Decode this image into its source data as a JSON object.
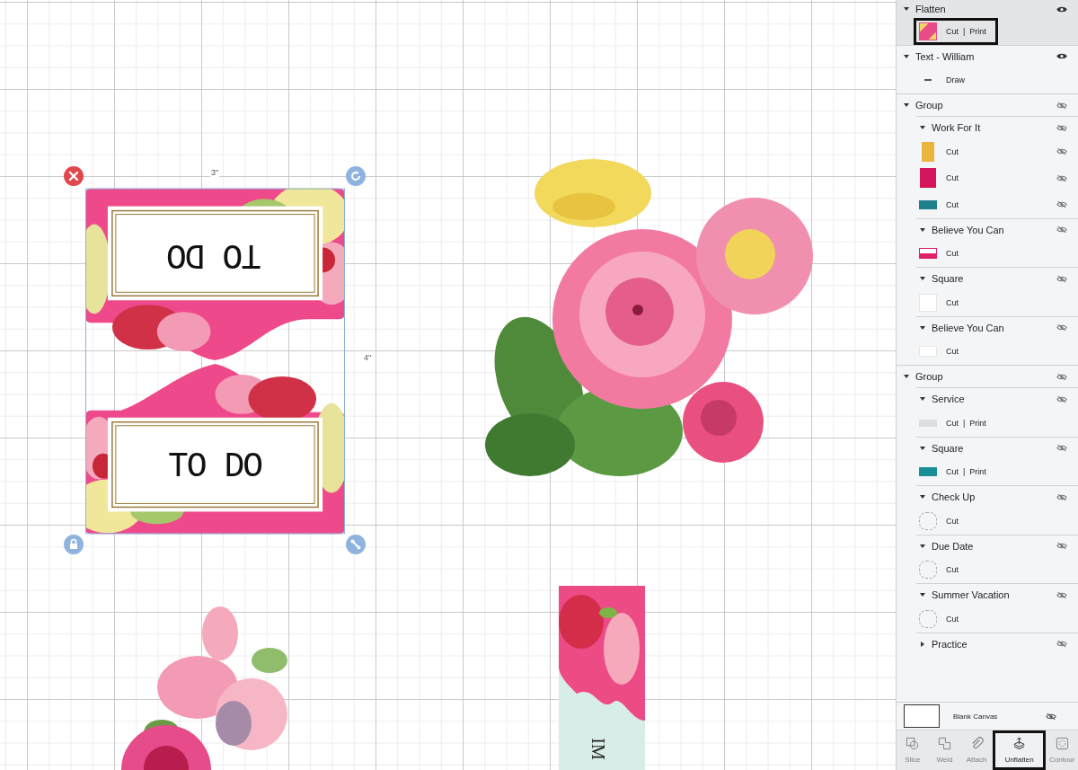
{
  "canvas": {
    "selection": {
      "width_label": "3\"",
      "height_label": "4\""
    },
    "card": {
      "top_text": "TO DO",
      "bottom_text": "TO DO"
    },
    "bookmark": {
      "text": "IM"
    }
  },
  "layers": [
    {
      "name": "Flatten",
      "expanded": true,
      "selected": true,
      "visible": true,
      "children": [
        {
          "kind": "pattern",
          "operation": "Cut  |  Print",
          "annotated": true
        }
      ]
    },
    {
      "name": "Text - William",
      "expanded": true,
      "selected": false,
      "visible": true,
      "children": [
        {
          "kind": "dash",
          "operation": "Draw"
        }
      ]
    },
    {
      "name": "Group",
      "expanded": true,
      "selected": false,
      "visible": false,
      "children": [
        {
          "name": "Work For It",
          "expanded": true,
          "selected": false,
          "visible": false,
          "children": [
            {
              "kind": "yellow-tag",
              "operation": "Cut",
              "visible": false
            },
            {
              "kind": "pink-tag",
              "operation": "Cut",
              "visible": false
            },
            {
              "kind": "teal-tag",
              "operation": "Cut",
              "visible": false
            }
          ]
        },
        {
          "name": "Believe You Can",
          "expanded": true,
          "selected": false,
          "visible": false,
          "children": [
            {
              "kind": "believe-tag",
              "operation": "Cut"
            }
          ]
        },
        {
          "name": "Square",
          "expanded": true,
          "selected": false,
          "visible": false,
          "children": [
            {
              "kind": "white-square",
              "operation": "Cut"
            }
          ]
        },
        {
          "name": "Believe You Can",
          "expanded": true,
          "selected": false,
          "visible": false,
          "children": [
            {
              "kind": "white-shape",
              "operation": "Cut"
            }
          ]
        }
      ]
    },
    {
      "name": "Group",
      "expanded": true,
      "selected": false,
      "visible": false,
      "children": [
        {
          "name": "Service",
          "expanded": true,
          "selected": false,
          "visible": false,
          "children": [
            {
              "kind": "faint",
              "operation": "Cut  |  Print"
            }
          ]
        },
        {
          "name": "Square",
          "expanded": true,
          "selected": false,
          "visible": false,
          "children": [
            {
              "kind": "teal-rect",
              "operation": "Cut  |  Print"
            }
          ]
        },
        {
          "name": "Check Up",
          "expanded": true,
          "selected": false,
          "visible": false,
          "children": [
            {
              "kind": "sketch",
              "operation": "Cut"
            }
          ]
        },
        {
          "name": "Due Date",
          "expanded": true,
          "selected": false,
          "visible": false,
          "children": [
            {
              "kind": "sketch",
              "operation": "Cut"
            }
          ]
        },
        {
          "name": "Summer Vacation",
          "expanded": true,
          "selected": false,
          "visible": false,
          "children": [
            {
              "kind": "sketch",
              "operation": "Cut"
            }
          ]
        },
        {
          "name": "Practice",
          "expanded": false,
          "selected": false,
          "visible": false
        }
      ]
    }
  ],
  "blank_canvas": {
    "label": "Blank Canvas",
    "visible": false
  },
  "toolbar": [
    {
      "label": "Slice",
      "disabled": true,
      "annotated": false
    },
    {
      "label": "Weld",
      "disabled": true,
      "annotated": false
    },
    {
      "label": "Attach",
      "disabled": true,
      "annotated": false
    },
    {
      "label": "Unflatten",
      "disabled": false,
      "annotated": true
    },
    {
      "label": "Contour",
      "disabled": true,
      "annotated": false
    }
  ]
}
